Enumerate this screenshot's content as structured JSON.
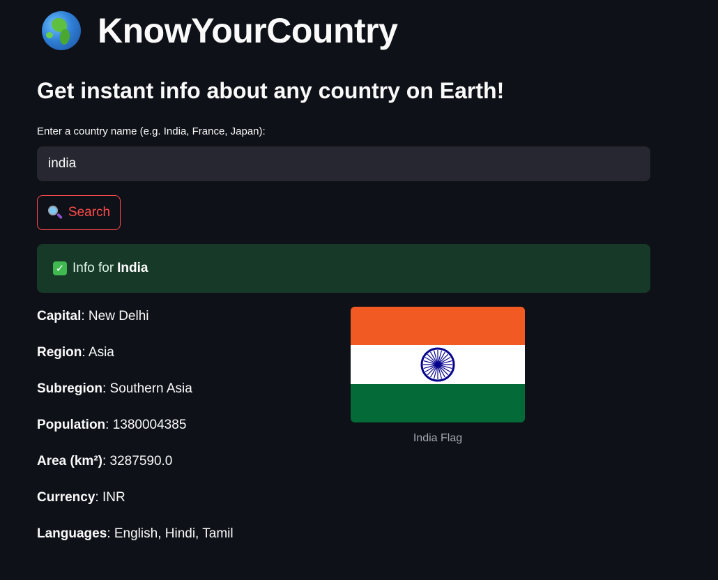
{
  "header": {
    "icon": "globe-icon",
    "title": "KnowYourCountry"
  },
  "subtitle": "Get instant info about any country on Earth!",
  "search": {
    "label": "Enter a country name (e.g. India, France, Japan):",
    "value": "india",
    "button_label": "Search",
    "button_icon": "magnifier-icon"
  },
  "result": {
    "prefix": "Info for",
    "country": "India",
    "icon": "check-icon",
    "facts": [
      {
        "key": "Capital",
        "value": "New Delhi"
      },
      {
        "key": "Region",
        "value": "Asia"
      },
      {
        "key": "Subregion",
        "value": "Southern Asia"
      },
      {
        "key": "Population",
        "value": "1380004385"
      },
      {
        "key": "Area (km²)",
        "value": "3287590.0"
      },
      {
        "key": "Currency",
        "value": "INR"
      },
      {
        "key": "Languages",
        "value": "English, Hindi, Tamil"
      }
    ],
    "flag_caption": "India Flag"
  },
  "colors": {
    "background": "#0e1117",
    "accent": "#ff4b4b",
    "success_bg": "#173928",
    "input_bg": "#262730",
    "flag_saffron": "#f15a22",
    "flag_white": "#ffffff",
    "flag_green": "#046a38",
    "chakra": "#06038d"
  }
}
